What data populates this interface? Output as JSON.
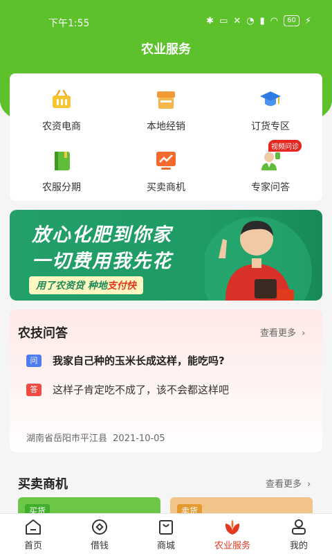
{
  "status_bar": {
    "time": "下午1:55",
    "battery": "60"
  },
  "header": {
    "title": "农业服务"
  },
  "services": [
    {
      "label": "农资电商",
      "icon": "basket-icon"
    },
    {
      "label": "本地经销",
      "icon": "store-icon"
    },
    {
      "label": "订货专区",
      "icon": "graduation-cap-icon"
    },
    {
      "label": "农服分期",
      "icon": "book-icon"
    },
    {
      "label": "买卖商机",
      "icon": "trend-chart-icon"
    },
    {
      "label": "专家问答",
      "icon": "expert-icon",
      "badge": "视频问诊"
    }
  ],
  "banner": {
    "line1": "放心化肥到你家",
    "line2": "一切费用我先花",
    "tag_prefix": "用了农资贷 种地",
    "tag_highlight": "支付快"
  },
  "qa": {
    "title": "农技问答",
    "more": "查看更多",
    "question_badge": "问",
    "question": "我家自己种的玉米长成这样，能吃吗?",
    "answer_badge": "答",
    "answer": "这样子肯定吃不成了，该不会都这样吧",
    "location": "湖南省岳阳市平江县",
    "date": "2021-10-05"
  },
  "trade": {
    "title": "买卖商机",
    "more": "查看更多",
    "cards": [
      {
        "tag": "买货"
      },
      {
        "tag": "卖货"
      }
    ]
  },
  "tabbar": [
    {
      "label": "首页",
      "icon": "home-icon"
    },
    {
      "label": "借钱",
      "icon": "money-icon"
    },
    {
      "label": "商城",
      "icon": "shop-bag-icon"
    },
    {
      "label": "农业服务",
      "icon": "leaf-icon",
      "active": true
    },
    {
      "label": "我的",
      "icon": "user-icon"
    }
  ],
  "colors": {
    "primary_green": "#5cc12b",
    "accent_red": "#e23a1d",
    "banner_green": "#1e9a63"
  }
}
